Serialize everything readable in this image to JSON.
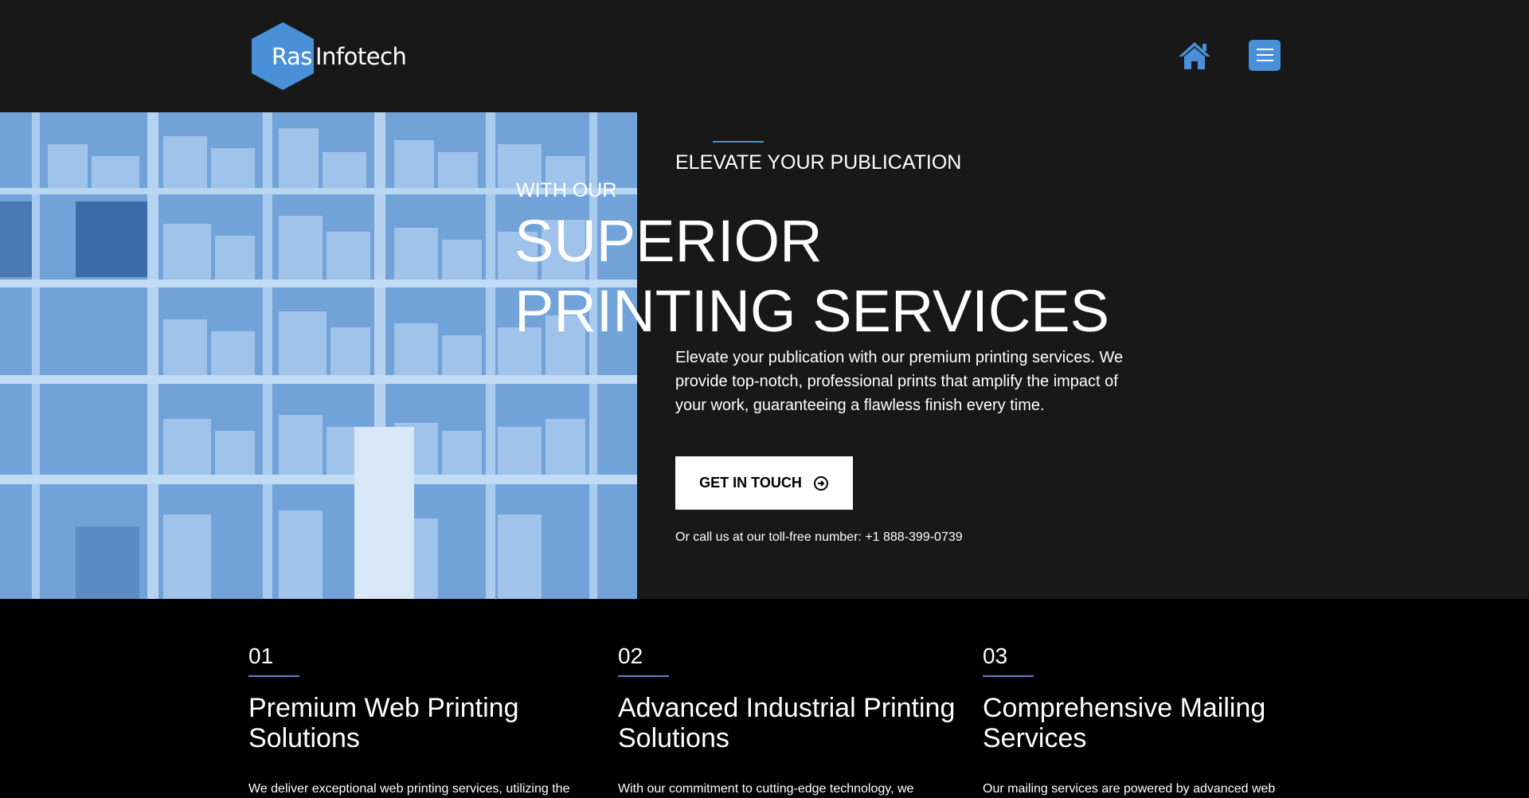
{
  "header": {
    "logo_part1": "Ras",
    "logo_part2": "Infotech",
    "accent_color": "#4a90d9",
    "home_icon": "home-icon",
    "menu_icon": "hamburger-menu-icon"
  },
  "hero": {
    "kicker": "ELEVATE YOUR PUBLICATION",
    "subkicker": "WITH OUR",
    "headline": "SUPERIOR PRINTING SERVICES",
    "description": "Elevate your publication with our premium printing services. We provide top-notch, professional prints that amplify the impact of your work, guaranteeing a flawless finish every time.",
    "cta_label": "GET IN TOUCH",
    "cta_icon": "circle-arrow-right-icon",
    "phone_text": "Or call us at our toll-free number: +1 888-399-0739"
  },
  "services": [
    {
      "number": "01",
      "title": "Premium Web Printing Solutions",
      "body": "We deliver exceptional web printing services, utilizing the"
    },
    {
      "number": "02",
      "title": "Advanced Industrial Printing Solutions",
      "body": "With our commitment to cutting-edge technology, we"
    },
    {
      "number": "03",
      "title": "Comprehensive Mailing Services",
      "body": "Our mailing services are powered by advanced web"
    }
  ]
}
